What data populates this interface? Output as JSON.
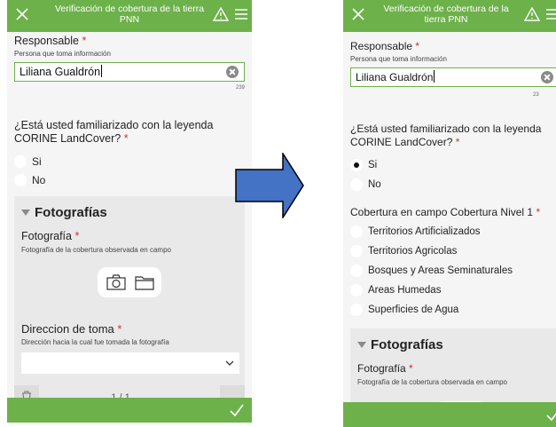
{
  "header": {
    "title": "Verificación de cobertura de la tierra PNN"
  },
  "form": {
    "responsable": {
      "label": "Responsable",
      "required": "*",
      "hint": "Persona que toma información",
      "value": "Liliana Gualdrón",
      "counter": "239",
      "counter_partial": "23"
    },
    "leyenda": {
      "question": "¿Está usted familiarizado con la leyenda CORINE LandCover?",
      "required": "*",
      "options": [
        "Si",
        "No"
      ]
    },
    "cobertura": {
      "label": "Cobertura en campo Cobertura Nivel 1",
      "required": "*",
      "options": [
        "Territorios Artificializados",
        "Territorios Agricolas",
        "Bosques y Areas Seminaturales",
        "Areas Humedas",
        "Superficies de Agua"
      ]
    },
    "fotografias": {
      "group_title": "Fotografías",
      "foto_label": "Fotografía",
      "foto_required": "*",
      "foto_hint": "Fotografía de la cobertura observada en campo",
      "direccion_label": "Direccion de toma",
      "direccion_required": "*",
      "direccion_hint": "Dirección hacia la cual fue tomada la fotografía",
      "pager": "1 / 1"
    }
  },
  "icons": [
    "close-icon",
    "warning-icon",
    "menu-icon",
    "clear-icon",
    "camera-icon",
    "folder-icon",
    "chevron-down-icon",
    "delete-icon",
    "checkmark-icon",
    "arrow-right-icon"
  ],
  "colors": {
    "accent": "#6db14a",
    "arrow": "#4472c4",
    "required": "#d0312d"
  }
}
